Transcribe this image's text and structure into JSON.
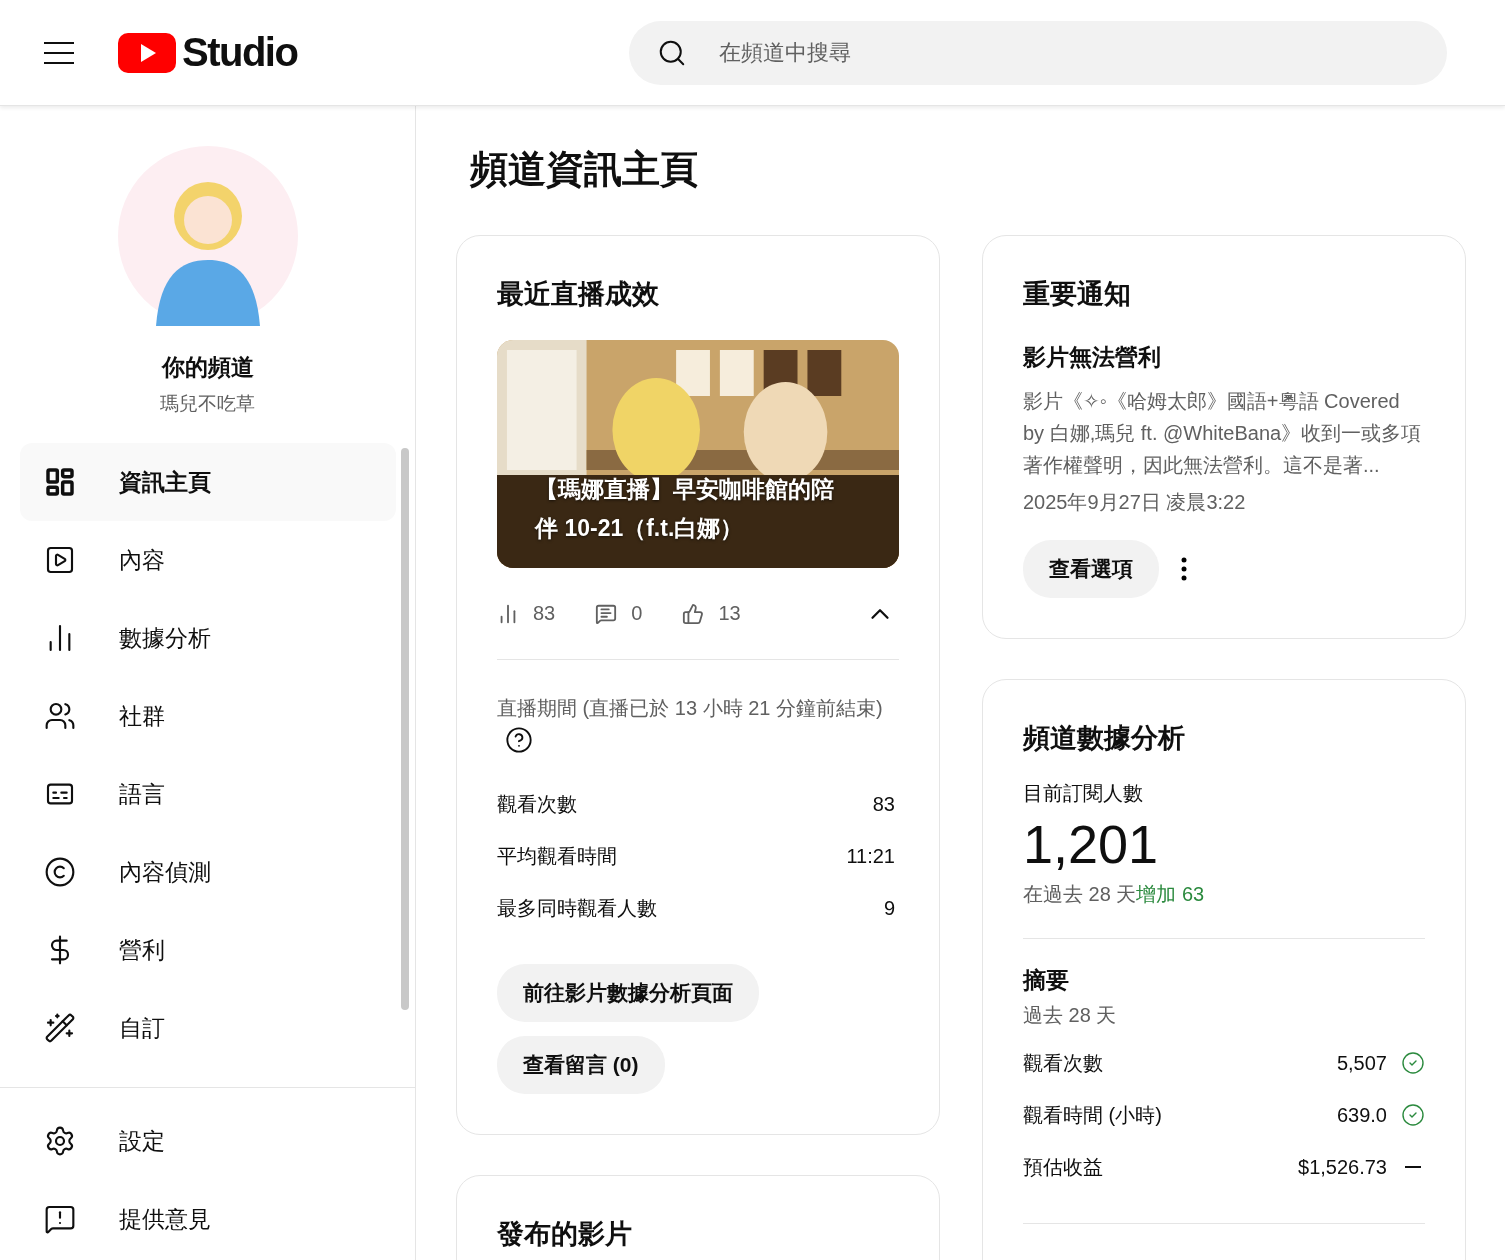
{
  "header": {
    "logo_text": "Studio",
    "search": {
      "placeholder": "在頻道中搜尋"
    }
  },
  "sidebar": {
    "channel_label": "你的頻道",
    "channel_name": "瑪兒不吃草",
    "items": [
      {
        "label": "資訊主頁",
        "selected": true
      },
      {
        "label": "內容",
        "selected": false
      },
      {
        "label": "數據分析",
        "selected": false
      },
      {
        "label": "社群",
        "selected": false
      },
      {
        "label": "語言",
        "selected": false
      },
      {
        "label": "內容偵測",
        "selected": false
      },
      {
        "label": "營利",
        "selected": false
      },
      {
        "label": "自訂",
        "selected": false
      }
    ],
    "footer_items": [
      {
        "label": "設定",
        "selected": false
      },
      {
        "label": "提供意見",
        "selected": false
      }
    ]
  },
  "page_title": "頻道資訊主頁",
  "live_card": {
    "title": "最近直播成效",
    "video_title": "【瑪娜直播】早安咖啡館的陪伴 10-21（f.t.白娜）",
    "stats": {
      "views": "83",
      "comments": "0",
      "likes": "13",
      "expanded": true
    },
    "period": "直播期間 (直播已於 13 小時 21 分鐘前結束)",
    "metrics": [
      {
        "label": "觀看次數",
        "value": "83"
      },
      {
        "label": "平均觀看時間",
        "value": "11:21"
      },
      {
        "label": "最多同時觀看人數",
        "value": "9"
      }
    ],
    "buttons": [
      "前往影片數據分析頁面",
      "查看留言 (0)"
    ]
  },
  "published_card": {
    "title": "發布的影片"
  },
  "notice_card": {
    "title": "重要通知",
    "headline": "影片無法營利",
    "body": "影片《✧◦《哈姆太郎》國語+粵語 Covered by 白娜,瑪兒 ft. @WhiteBana》收到一或多項著作權聲明，因此無法營利。這不是著...",
    "date": "2025年9月27日 凌晨3:22",
    "button": "查看選項"
  },
  "analytics_card": {
    "title": "頻道數據分析",
    "subscribers_label": "目前訂閱人數",
    "subscribers": "1,201",
    "change_prefix": "在過去 28 天",
    "change": "增加 63",
    "summary_title": "摘要",
    "summary_period": "過去 28 天",
    "summary": [
      {
        "label": "觀看次數",
        "value": "5,507",
        "kind": "check"
      },
      {
        "label": "觀看時間 (小時)",
        "value": "639.0",
        "kind": "check"
      },
      {
        "label": "預估收益",
        "value": "$1,526.73",
        "kind": "dash"
      }
    ]
  }
}
